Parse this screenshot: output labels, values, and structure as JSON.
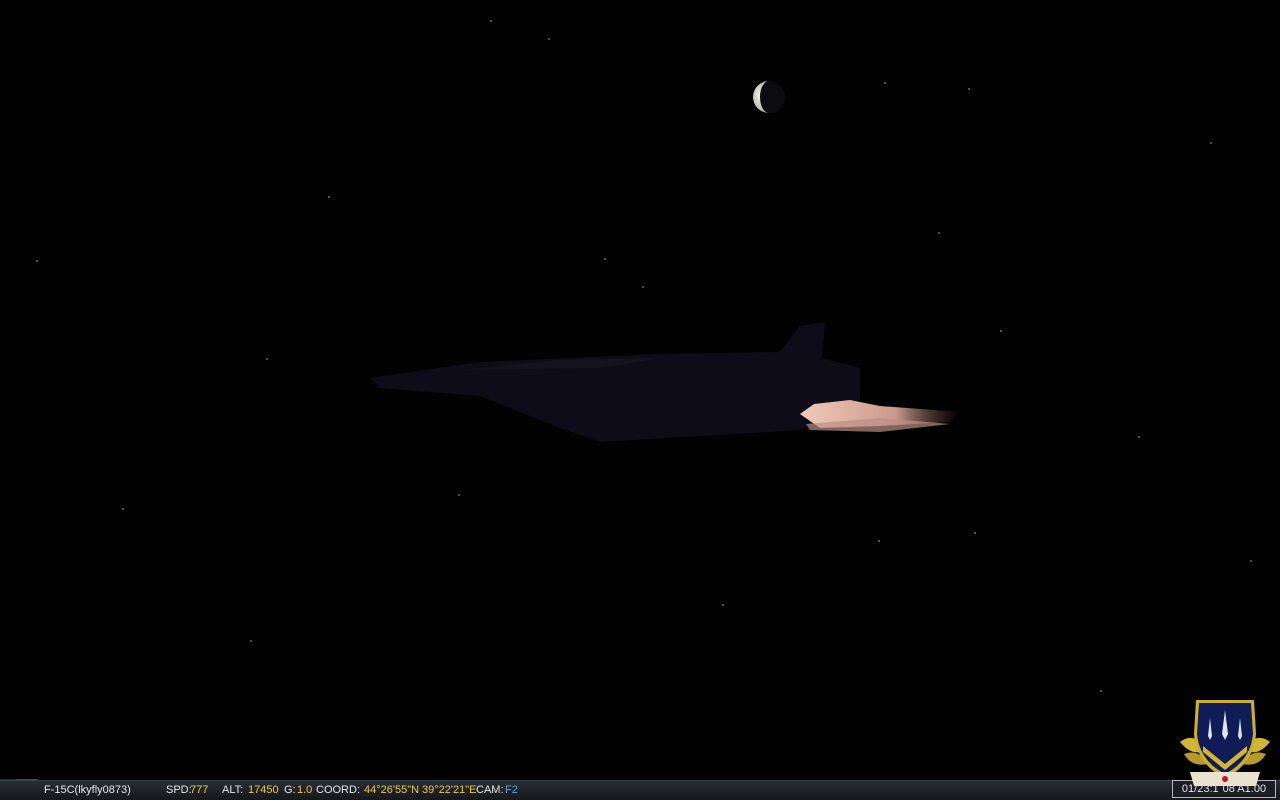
{
  "hud": {
    "aircraft_label": "F-15C(lkyfly0873)",
    "spd_label": "SPD:",
    "spd_value": "777",
    "alt_label": "ALT:",
    "alt_value": "17450",
    "g_label": "G:",
    "g_value": "1.0",
    "coord_label": "COORD:",
    "lat_value": "44°26'55\"N",
    "lon_value": "39°22'21\"E",
    "cam_label": "CAM:",
    "cam_value": "F2",
    "clock": "01/23:1",
    "clock_tail": "08 A1.00"
  },
  "icons": {
    "flag": "us-flag-icon",
    "emblem": "squadron-emblem-icon",
    "moon": "crescent-moon-icon"
  },
  "colors": {
    "sky": "#020203",
    "value_highlight": "#e8c84a",
    "camera_highlight": "#4aa8e8",
    "afterburner": "#e9b8a8"
  }
}
